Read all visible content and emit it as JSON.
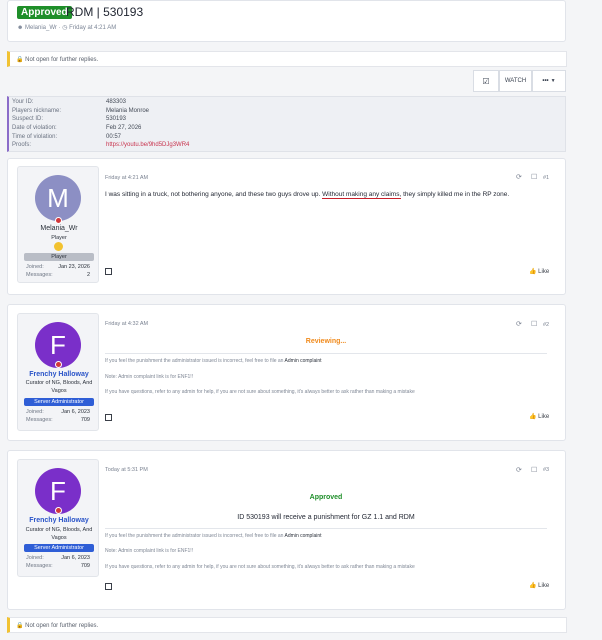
{
  "thread": {
    "status_badge": "Approved",
    "title": "RDM | 530193",
    "author": "Melania_Wr",
    "date": "Friday at 4:21 AM"
  },
  "notice_text": "Not open for further replies.",
  "toolbar": {
    "watch_label": "WATCH",
    "more_label": "•••"
  },
  "info": {
    "labels": [
      "Your ID:",
      "Players nickname:",
      "Suspect ID:",
      "Date of violation:",
      "Time of violation:",
      "Proofs:"
    ],
    "values": [
      "483303",
      "Melania Monroe",
      "530193",
      "Feb 27, 2026",
      "00:57",
      "https://youtu.be/9hd5DJg3WR4"
    ]
  },
  "posts": [
    {
      "avatar_letter": "M",
      "avatar_color": "#8c8fc4",
      "username": "Melania_Wr",
      "user_title": "Player",
      "banner": "Player",
      "joined_label": "Joined:",
      "joined": "Jan 23, 2026",
      "messages_label": "Messages:",
      "messages": "2",
      "date": "Friday at 4:21 AM",
      "number": "#1",
      "body_pre": "I was sitting in a truck, not bothering anyone, and these two guys drove up. ",
      "body_underlined": "Without making any claims,",
      "body_post": " they simply killed me in the RP zone.",
      "like": "Like"
    },
    {
      "avatar_letter": "F",
      "avatar_color": "#7a2fc9",
      "username": "Frenchy Halloway",
      "user_title_1": "Curator of NG, Bloods, And",
      "user_title_2": "Vagos",
      "banner": "Server Administrator",
      "joined_label": "Joined:",
      "joined": "Jan 6, 2023",
      "messages_label": "Messages:",
      "messages": "709",
      "date": "Friday at 4:32 AM",
      "number": "#2",
      "status": "Reviewing...",
      "line1_pre": "If you feel the punishment the administrator issued is incorrect, feel free to file an ",
      "line1_link": "Admin complaint",
      "line2": "Note: Admin complaint link is for ENF1!!",
      "line3": "If you have questions, refer to any admin for help, if you are not sure about something, it's always better to ask rather than making a mistake",
      "like": "Like"
    },
    {
      "avatar_letter": "F",
      "avatar_color": "#7a2fc9",
      "username": "Frenchy Halloway",
      "user_title_1": "Curator of NG, Bloods, And",
      "user_title_2": "Vagos",
      "banner": "Server Administrator",
      "joined_label": "Joined:",
      "joined": "Jan 6, 2023",
      "messages_label": "Messages:",
      "messages": "709",
      "date": "Today at 5:31 PM",
      "number": "#3",
      "status": "Approved",
      "verdict": "ID 530193 will receive a punishment for GZ 1.1 and RDM",
      "line1_pre": "If you feel the punishment the administrator issued is incorrect, feel free to file an ",
      "line1_link": "Admin complaint",
      "line2": "Note: Admin complaint link is for ENF1!!",
      "line3": "If you have questions, refer to any admin for help, if you are not sure about something, it's always better to ask rather than making a mistake",
      "like": "Like"
    }
  ],
  "colors": {
    "approved_green": "#1f8f2a",
    "reviewing_orange": "#f08a1c",
    "admin_blue": "#2f5ed6",
    "player_gray": "#b9bdc6",
    "link_red": "#c8344e"
  }
}
